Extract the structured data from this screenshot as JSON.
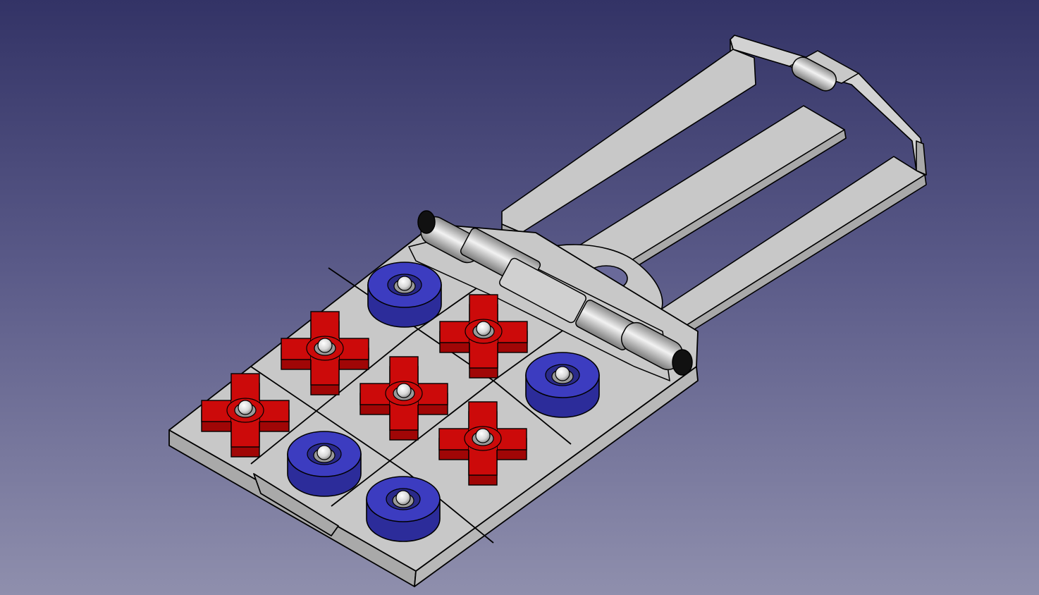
{
  "viewport": {
    "background_top": "#333366",
    "background_bottom": "#8f8fad"
  },
  "model": {
    "body_color": "#c8c8c8",
    "body_side_color": "#a9a9a9",
    "edge_color": "#000000",
    "x_piece_color": "#cc0a0a",
    "o_piece_color": "#3c3cc0",
    "knob_color": "#e6e6e6",
    "board": {
      "rows": 3,
      "cols": 3,
      "cells": [
        [
          "X",
          "X",
          "O"
        ],
        [
          "O",
          "X",
          "X"
        ],
        [
          "O",
          "X",
          "O"
        ]
      ]
    },
    "icons": [
      "ball-knob-icon",
      "hinge-icon",
      "slot-icon"
    ]
  }
}
